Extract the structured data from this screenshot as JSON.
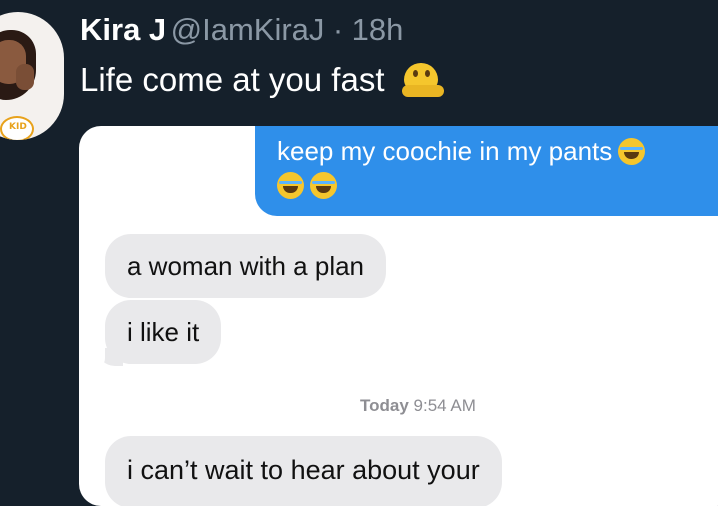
{
  "tweet": {
    "author_name": "Kira J",
    "author_handle": "@IamKiraJ",
    "separator": "·",
    "time": "18h",
    "text": "Life come at you fast",
    "emoji_icon": "melting-face-emoji",
    "avatar_badge": "KID"
  },
  "conversation": {
    "sent_message": "keep my coochie in my pants",
    "sent_emoji_icon": "face-with-tears-of-joy-emoji",
    "received": [
      "a woman with a plan",
      "i like it"
    ],
    "timestamp_day": "Today",
    "timestamp_time": "9:54 AM",
    "received_after": "i can’t wait to hear about your"
  },
  "colors": {
    "background": "#15202b",
    "sent_bubble": "#2f8fea",
    "received_bubble": "#e9e9eb",
    "secondary_text": "#8b98a5"
  }
}
